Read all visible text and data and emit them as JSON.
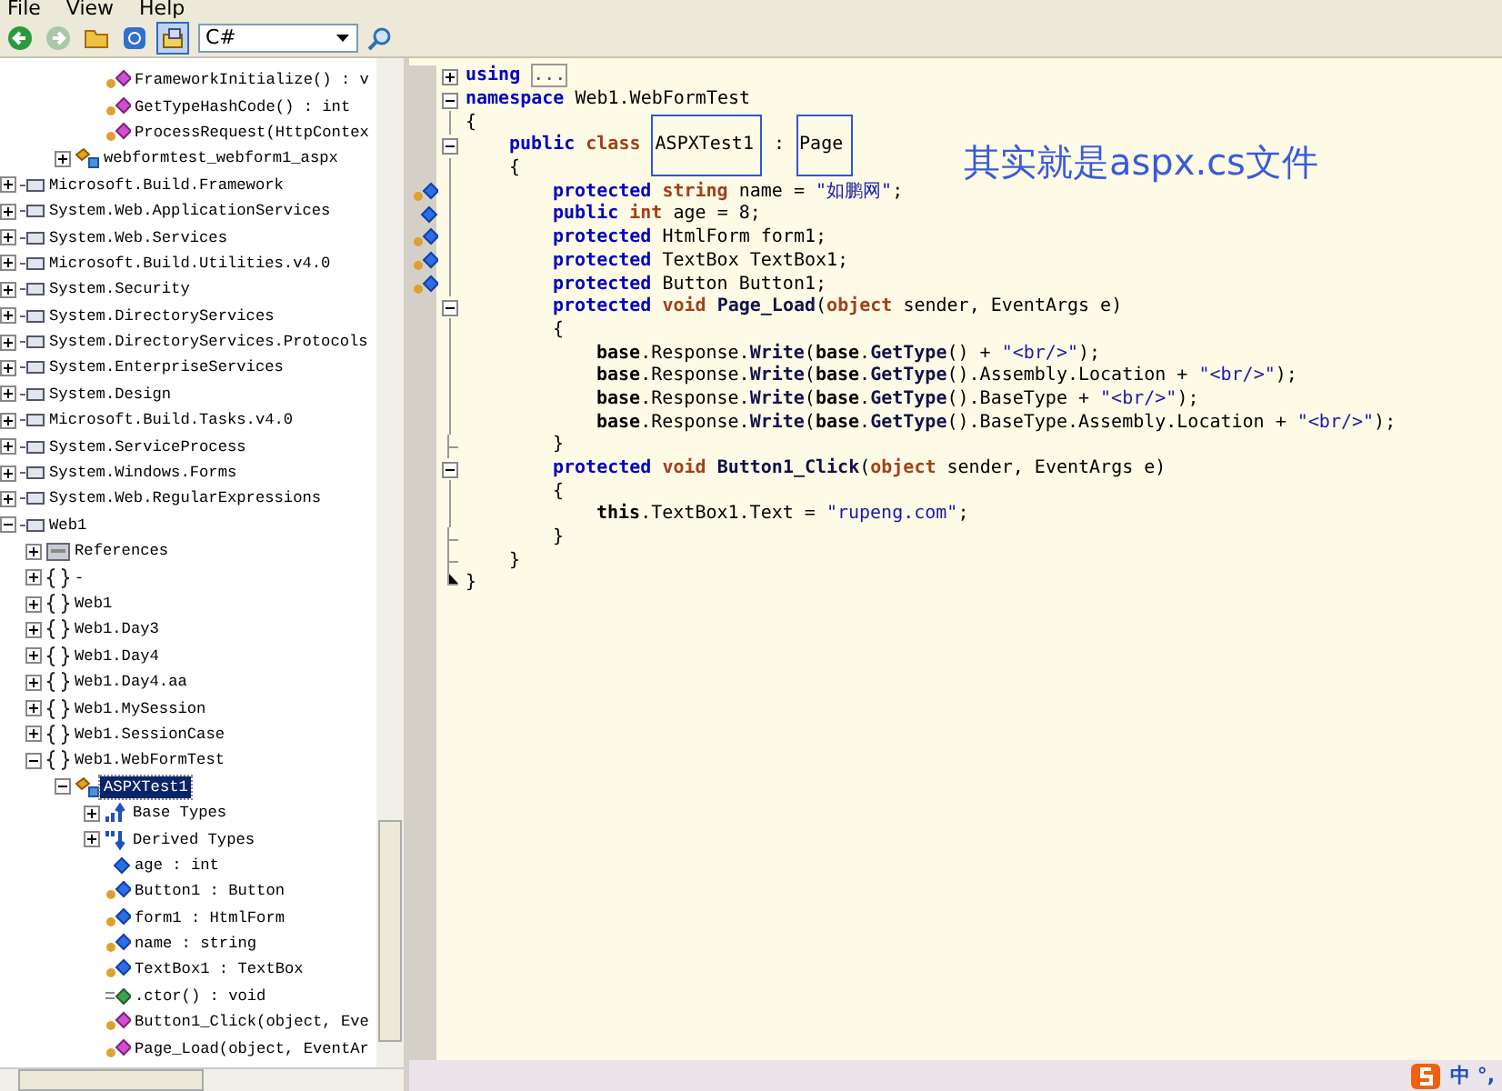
{
  "menu": [
    "File",
    "View",
    "Help"
  ],
  "toolbar": {
    "language": "C#"
  },
  "tree": {
    "continued_members": [
      {
        "label": "FrameworkInitialize() : v",
        "kind": "method",
        "selected": false
      },
      {
        "label": "GetTypeHashCode() : int",
        "kind": "method",
        "selected": false
      },
      {
        "label": "ProcessRequest(HttpContex",
        "kind": "method",
        "selected": false
      }
    ],
    "continued_classes": [
      {
        "label": "webformtest_webform1_aspx",
        "kind": "class",
        "expanded": false,
        "selected": false
      }
    ],
    "nodes": [
      {
        "label": "Microsoft.Build.Framework",
        "kind": "assembly",
        "expanded": false,
        "selected": false
      },
      {
        "label": "System.Web.ApplicationServices",
        "kind": "assembly",
        "expanded": false,
        "selected": false
      },
      {
        "label": "System.Web.Services",
        "kind": "assembly",
        "expanded": false,
        "selected": false
      },
      {
        "label": "Microsoft.Build.Utilities.v4.0",
        "kind": "assembly",
        "expanded": false,
        "selected": false
      },
      {
        "label": "System.Security",
        "kind": "assembly",
        "expanded": false,
        "selected": false
      },
      {
        "label": "System.DirectoryServices",
        "kind": "assembly",
        "expanded": false,
        "selected": false
      },
      {
        "label": "System.DirectoryServices.Protocols",
        "kind": "assembly",
        "expanded": false,
        "selected": false
      },
      {
        "label": "System.EnterpriseServices",
        "kind": "assembly",
        "expanded": false,
        "selected": false
      },
      {
        "label": "System.Design",
        "kind": "assembly",
        "expanded": false,
        "selected": false
      },
      {
        "label": "Microsoft.Build.Tasks.v4.0",
        "kind": "assembly",
        "expanded": false,
        "selected": false
      },
      {
        "label": "System.ServiceProcess",
        "kind": "assembly",
        "expanded": false,
        "selected": false
      },
      {
        "label": "System.Windows.Forms",
        "kind": "assembly",
        "expanded": false,
        "selected": false
      },
      {
        "label": "System.Web.RegularExpressions",
        "kind": "assembly",
        "expanded": false,
        "selected": false
      },
      {
        "label": "Web1",
        "kind": "assembly",
        "expanded": true,
        "selected": false,
        "children": [
          {
            "label": "References",
            "kind": "folder",
            "expanded": false,
            "selected": false
          },
          {
            "label": "-",
            "kind": "namespace",
            "expanded": false,
            "selected": false
          },
          {
            "label": "Web1",
            "kind": "namespace",
            "expanded": false,
            "selected": false
          },
          {
            "label": "Web1.Day3",
            "kind": "namespace",
            "expanded": false,
            "selected": false
          },
          {
            "label": "Web1.Day4",
            "kind": "namespace",
            "expanded": false,
            "selected": false
          },
          {
            "label": "Web1.Day4.aa",
            "kind": "namespace",
            "expanded": false,
            "selected": false
          },
          {
            "label": "Web1.MySession",
            "kind": "namespace",
            "expanded": false,
            "selected": false
          },
          {
            "label": "Web1.SessionCase",
            "kind": "namespace",
            "expanded": false,
            "selected": false
          },
          {
            "label": "Web1.WebFormTest",
            "kind": "namespace",
            "expanded": true,
            "selected": false,
            "children": [
              {
                "label": "ASPXTest1",
                "kind": "class",
                "expanded": true,
                "selected": true,
                "children": [
                  {
                    "label": "Base Types",
                    "kind": "basetypes",
                    "expanded": false,
                    "selected": false
                  },
                  {
                    "label": "Derived Types",
                    "kind": "derivedtypes",
                    "expanded": false,
                    "selected": false
                  },
                  {
                    "label": "age : int",
                    "kind": "field",
                    "selected": false
                  },
                  {
                    "label": "Button1 : Button",
                    "kind": "protected_field",
                    "selected": false
                  },
                  {
                    "label": "form1 : HtmlForm",
                    "kind": "protected_field",
                    "selected": false
                  },
                  {
                    "label": "name : string",
                    "kind": "protected_field",
                    "selected": false
                  },
                  {
                    "label": "TextBox1 : TextBox",
                    "kind": "protected_field",
                    "selected": false
                  },
                  {
                    "label": ".ctor() : void",
                    "kind": "ctor",
                    "selected": false
                  },
                  {
                    "label": "Button1_Click(object, Eve",
                    "kind": "method",
                    "selected": false
                  },
                  {
                    "label": "Page_Load(object, EventAr",
                    "kind": "method",
                    "selected": false
                  }
                ]
              }
            ]
          }
        ]
      }
    ]
  },
  "code": [
    {
      "kind": "fold_collapsed",
      "tokens": [
        {
          "text": "using",
          "kind": "keyword"
        },
        {
          "text": "...",
          "kind": "collapsed"
        }
      ]
    },
    {
      "kind": "fold_open",
      "tokens": [
        {
          "text": "namespace",
          "kind": "keyword"
        },
        {
          "text": " Web1.WebFormTest",
          "kind": "plain"
        }
      ]
    },
    {
      "kind": "body",
      "tokens": [
        {
          "text": "{",
          "kind": "plain"
        }
      ],
      "children": [
        {
          "kind": "fold_open",
          "tokens": [
            {
              "text": "public",
              "kind": "keyword"
            },
            {
              "text": " class ",
              "kind": "type"
            },
            {
              "text": "ASPXTest1",
              "kind": "boxed"
            },
            {
              "text": " : ",
              "kind": "plain"
            },
            {
              "text": "Page",
              "kind": "boxed"
            }
          ]
        },
        {
          "kind": "body",
          "tokens": [
            {
              "text": "{",
              "kind": "plain"
            }
          ],
          "children": [
            {
              "kind": "body",
              "member_icon": {
                "kind": "protected_field"
              },
              "tokens": [
                {
                  "text": "protected",
                  "kind": "keyword"
                },
                {
                  "text": " string",
                  "kind": "type"
                },
                {
                  "text": " name = ",
                  "kind": "plain"
                },
                {
                  "text": "\"如鹏网\"",
                  "kind": "string"
                },
                {
                  "text": ";",
                  "kind": "plain"
                }
              ]
            },
            {
              "kind": "body",
              "member_icon": {
                "kind": "field"
              },
              "tokens": [
                {
                  "text": "public",
                  "kind": "keyword"
                },
                {
                  "text": " int",
                  "kind": "type"
                },
                {
                  "text": " age = 8;",
                  "kind": "plain"
                }
              ]
            },
            {
              "kind": "body",
              "member_icon": {
                "kind": "protected_field"
              },
              "tokens": [
                {
                  "text": "protected",
                  "kind": "keyword"
                },
                {
                  "text": " HtmlForm form1;",
                  "kind": "plain"
                }
              ]
            },
            {
              "kind": "body",
              "member_icon": {
                "kind": "protected_field"
              },
              "tokens": [
                {
                  "text": "protected",
                  "kind": "keyword"
                },
                {
                  "text": " TextBox TextBox1;",
                  "kind": "plain"
                }
              ]
            },
            {
              "kind": "body",
              "member_icon": {
                "kind": "protected_field"
              },
              "tokens": [
                {
                  "text": "protected",
                  "kind": "keyword"
                },
                {
                  "text": " Button Button1;",
                  "kind": "plain"
                }
              ]
            },
            {
              "kind": "fold_open",
              "tokens": [
                {
                  "text": "protected",
                  "kind": "keyword"
                },
                {
                  "text": " void",
                  "kind": "type"
                },
                {
                  "text": " Page_Load",
                  "kind": "member"
                },
                {
                  "text": "(",
                  "kind": "plain"
                },
                {
                  "text": "object",
                  "kind": "type"
                },
                {
                  "text": " sender, EventArgs e)",
                  "kind": "plain"
                }
              ]
            },
            {
              "kind": "body",
              "tokens": [
                {
                  "text": "{",
                  "kind": "plain"
                }
              ],
              "children": [
                {
                  "kind": "body",
                  "tokens": [
                    {
                      "text": "base",
                      "kind": "self"
                    },
                    {
                      "text": ".Response.",
                      "kind": "plain"
                    },
                    {
                      "text": "Write",
                      "kind": "member"
                    },
                    {
                      "text": "(",
                      "kind": "plain"
                    },
                    {
                      "text": "base",
                      "kind": "self"
                    },
                    {
                      "text": ".",
                      "kind": "plain"
                    },
                    {
                      "text": "GetType",
                      "kind": "member"
                    },
                    {
                      "text": "() + ",
                      "kind": "plain"
                    },
                    {
                      "text": "\"<br/>\"",
                      "kind": "string"
                    },
                    {
                      "text": ");",
                      "kind": "plain"
                    }
                  ]
                },
                {
                  "kind": "body",
                  "tokens": [
                    {
                      "text": "base",
                      "kind": "self"
                    },
                    {
                      "text": ".Response.",
                      "kind": "plain"
                    },
                    {
                      "text": "Write",
                      "kind": "member"
                    },
                    {
                      "text": "(",
                      "kind": "plain"
                    },
                    {
                      "text": "base",
                      "kind": "self"
                    },
                    {
                      "text": ".",
                      "kind": "plain"
                    },
                    {
                      "text": "GetType",
                      "kind": "member"
                    },
                    {
                      "text": "().Assembly.Location + ",
                      "kind": "plain"
                    },
                    {
                      "text": "\"<br/>\"",
                      "kind": "string"
                    },
                    {
                      "text": ");",
                      "kind": "plain"
                    }
                  ]
                },
                {
                  "kind": "body",
                  "tokens": [
                    {
                      "text": "base",
                      "kind": "self"
                    },
                    {
                      "text": ".Response.",
                      "kind": "plain"
                    },
                    {
                      "text": "Write",
                      "kind": "member"
                    },
                    {
                      "text": "(",
                      "kind": "plain"
                    },
                    {
                      "text": "base",
                      "kind": "self"
                    },
                    {
                      "text": ".",
                      "kind": "plain"
                    },
                    {
                      "text": "GetType",
                      "kind": "member"
                    },
                    {
                      "text": "().BaseType + ",
                      "kind": "plain"
                    },
                    {
                      "text": "\"<br/>\"",
                      "kind": "string"
                    },
                    {
                      "text": ");",
                      "kind": "plain"
                    }
                  ]
                },
                {
                  "kind": "body",
                  "tokens": [
                    {
                      "text": "base",
                      "kind": "self"
                    },
                    {
                      "text": ".Response.",
                      "kind": "plain"
                    },
                    {
                      "text": "Write",
                      "kind": "member"
                    },
                    {
                      "text": "(",
                      "kind": "plain"
                    },
                    {
                      "text": "base",
                      "kind": "self"
                    },
                    {
                      "text": ".",
                      "kind": "plain"
                    },
                    {
                      "text": "GetType",
                      "kind": "member"
                    },
                    {
                      "text": "().BaseType.Assembly.Location + ",
                      "kind": "plain"
                    },
                    {
                      "text": "\"<br/>\"",
                      "kind": "string"
                    },
                    {
                      "text": ");",
                      "kind": "plain"
                    }
                  ]
                }
              ]
            },
            {
              "kind": "fold_end",
              "tokens": [
                {
                  "text": "}",
                  "kind": "plain"
                }
              ]
            },
            {
              "kind": "fold_open",
              "tokens": [
                {
                  "text": "protected",
                  "kind": "keyword"
                },
                {
                  "text": " void",
                  "kind": "type"
                },
                {
                  "text": " Button1_Click",
                  "kind": "member"
                },
                {
                  "text": "(",
                  "kind": "plain"
                },
                {
                  "text": "object",
                  "kind": "type"
                },
                {
                  "text": " sender, EventArgs e)",
                  "kind": "plain"
                }
              ]
            },
            {
              "kind": "body",
              "tokens": [
                {
                  "text": "{",
                  "kind": "plain"
                }
              ],
              "children": [
                {
                  "kind": "body",
                  "tokens": [
                    {
                      "text": "this",
                      "kind": "self"
                    },
                    {
                      "text": ".TextBox1.Text = ",
                      "kind": "plain"
                    },
                    {
                      "text": "\"rupeng.com\"",
                      "kind": "string"
                    },
                    {
                      "text": ";",
                      "kind": "plain"
                    }
                  ]
                }
              ]
            },
            {
              "kind": "fold_end",
              "tokens": [
                {
                  "text": "}",
                  "kind": "plain"
                }
              ]
            }
          ]
        },
        {
          "kind": "fold_end",
          "tokens": [
            {
              "text": "}",
              "kind": "plain"
            }
          ]
        }
      ]
    },
    {
      "kind": "fold_close",
      "tokens": [
        {
          "text": "}",
          "kind": "plain"
        }
      ]
    }
  ],
  "caption": "其实就是aspx.cs文件",
  "ime": {
    "mode": "中",
    "punct": "°,"
  }
}
